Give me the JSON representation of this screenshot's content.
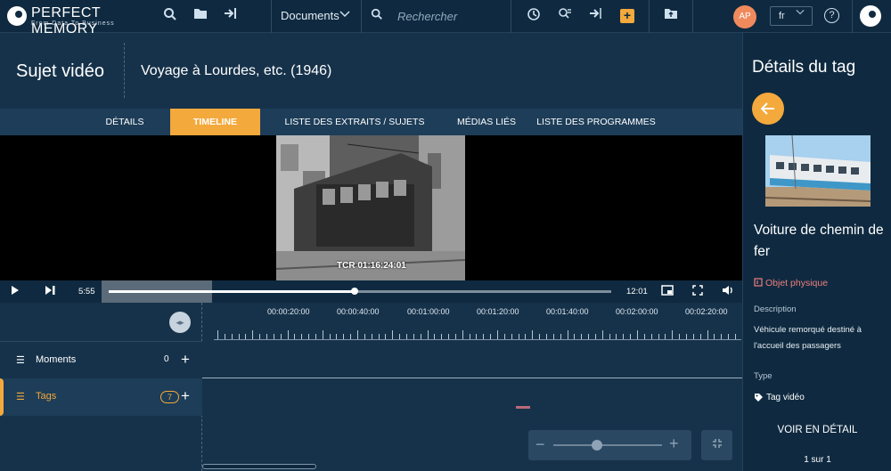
{
  "topbar": {
    "brand": "PERFECT MEMORY",
    "brand_tagline": "From Data To Business",
    "documents_label": "Documents",
    "search_placeholder": "Rechercher",
    "avatar_initials": "AP",
    "language": "fr",
    "help_glyph": "?"
  },
  "header": {
    "title": "Sujet vidéo",
    "subtitle": "Voyage à Lourdes, etc. (1946)"
  },
  "tabs": [
    {
      "label": "Détails",
      "active": false
    },
    {
      "label": "Timeline",
      "active": true
    },
    {
      "label": "Liste des extraits / sujets utilisés",
      "active": false
    },
    {
      "label": "Médias liés",
      "active": false
    },
    {
      "label": "Liste des programmes",
      "active": false
    }
  ],
  "video": {
    "timecode": "TCR 01:16:24:01",
    "current_time": "5:55",
    "duration": "12:01",
    "progress": 0.49
  },
  "timeline": {
    "ruler_labels": [
      "00:00:20:00",
      "00:00:40:00",
      "00:01:00:00",
      "00:01:20:00",
      "00:01:40:00",
      "00:02:00:00",
      "00:02:20:00"
    ],
    "rows": {
      "moments": {
        "label": "Moments",
        "count": "0"
      },
      "tags": {
        "label": "Tags",
        "count": "7"
      }
    },
    "zoom_level": 0.4
  },
  "panel": {
    "title": "Détails du tag",
    "tag_name": "Voiture de chemin de fer",
    "category": "Objet physique",
    "description_label": "Description",
    "description": "Véhicule remorqué destiné à l'accueil des passagers",
    "type_label": "Type",
    "type_value": "Tag vidéo",
    "detail_button": "Voir en détail",
    "pager": "1 sur 1"
  },
  "icons": {
    "accent_color": "#f4a93c",
    "background_color": "#16324a",
    "category_color": "#ef7e7e"
  }
}
